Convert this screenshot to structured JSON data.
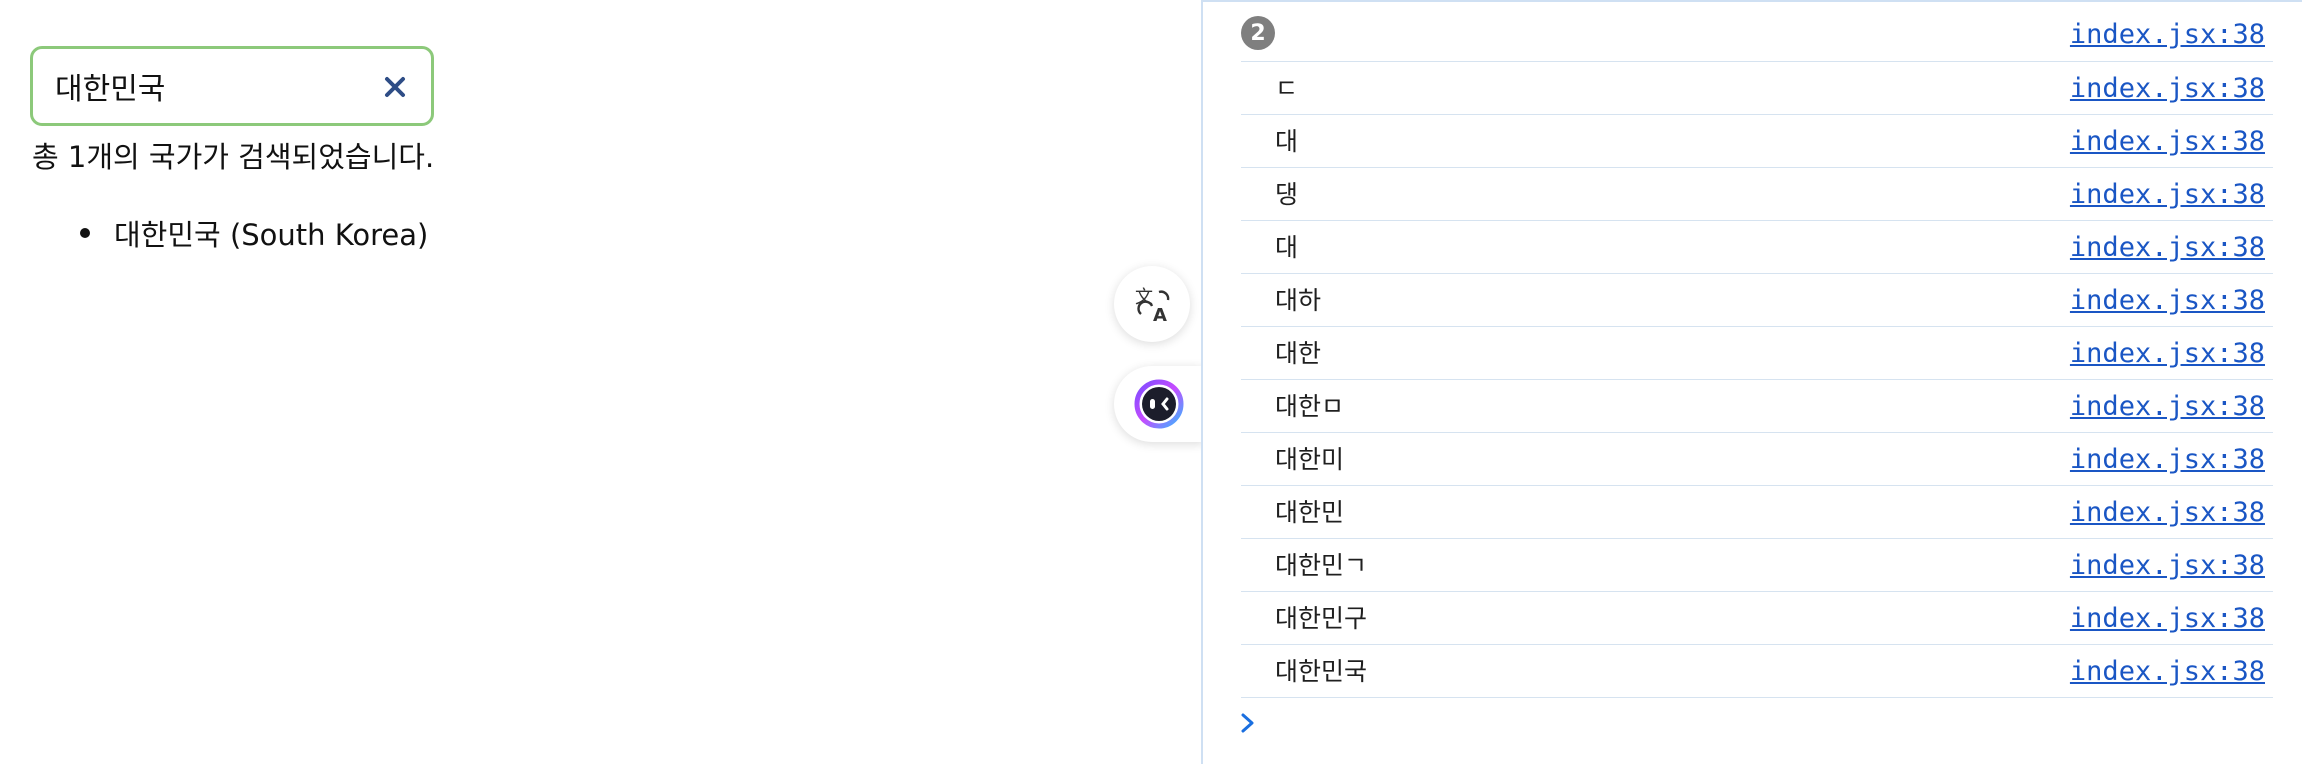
{
  "app": {
    "search": {
      "value": "대한민국",
      "clear_icon": "close-icon",
      "border_color": "#8cc97a"
    },
    "result_count_text": "총 1개의 국가가 검색되었습니다.",
    "results": [
      {
        "label": "대한민국 (South Korea)"
      }
    ],
    "floating_buttons": {
      "translate_icon": "translate-icon",
      "assistant_icon": "assistant-icon"
    }
  },
  "console": {
    "badge_count": "2",
    "link_color": "#1a56c4",
    "logs": [
      {
        "message": "",
        "source": "index.jsx:38"
      },
      {
        "message": "ㄷ",
        "source": "index.jsx:38"
      },
      {
        "message": "대",
        "source": "index.jsx:38"
      },
      {
        "message": "댕",
        "source": "index.jsx:38"
      },
      {
        "message": "대",
        "source": "index.jsx:38"
      },
      {
        "message": "대하",
        "source": "index.jsx:38"
      },
      {
        "message": "대한",
        "source": "index.jsx:38"
      },
      {
        "message": "대한ㅁ",
        "source": "index.jsx:38"
      },
      {
        "message": "대한미",
        "source": "index.jsx:38"
      },
      {
        "message": "대한민",
        "source": "index.jsx:38"
      },
      {
        "message": "대한민ㄱ",
        "source": "index.jsx:38"
      },
      {
        "message": "대한민구",
        "source": "index.jsx:38"
      },
      {
        "message": "대한민국",
        "source": "index.jsx:38"
      }
    ],
    "prompt_icon": "chevron-right-icon"
  }
}
